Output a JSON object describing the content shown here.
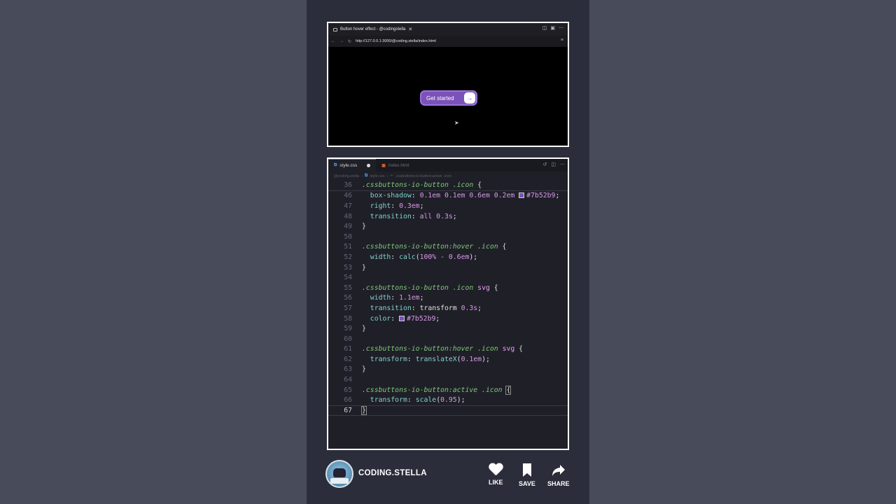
{
  "browser": {
    "tab_title": "Button hover effect - @codingstella",
    "tab_close": "✕",
    "url": "http://127.0.0.1:3000/@coding.stella/index.html",
    "button_label": "Get started",
    "button_icon": "→",
    "accent_color": "#7b52b9"
  },
  "editor": {
    "tabs": [
      {
        "label": "style.css",
        "icon": "css-icon",
        "modified": true
      },
      {
        "label": "index.html",
        "icon": "html-icon",
        "modified": false
      }
    ],
    "breadcrumb": [
      "@coding.stella",
      "style.css",
      ".cssbuttons-io-button:active .icon"
    ],
    "sticky_line": {
      "num": "36",
      "text": ".cssbuttons-io-button .icon {"
    },
    "lines": [
      {
        "num": "46",
        "text": "  box-shadow: 0.1em 0.1em 0.6em 0.2em #7b52b9;"
      },
      {
        "num": "47",
        "text": "  right: 0.3em;"
      },
      {
        "num": "48",
        "text": "  transition: all 0.3s;"
      },
      {
        "num": "49",
        "text": "}"
      },
      {
        "num": "50",
        "text": ""
      },
      {
        "num": "51",
        "text": ".cssbuttons-io-button:hover .icon {"
      },
      {
        "num": "52",
        "text": "  width: calc(100% - 0.6em);"
      },
      {
        "num": "53",
        "text": "}"
      },
      {
        "num": "54",
        "text": ""
      },
      {
        "num": "55",
        "text": ".cssbuttons-io-button .icon svg {"
      },
      {
        "num": "56",
        "text": "  width: 1.1em;"
      },
      {
        "num": "57",
        "text": "  transition: transform 0.3s;"
      },
      {
        "num": "58",
        "text": "  color: #7b52b9;"
      },
      {
        "num": "59",
        "text": "}"
      },
      {
        "num": "60",
        "text": ""
      },
      {
        "num": "61",
        "text": ".cssbuttons-io-button:hover .icon svg {"
      },
      {
        "num": "62",
        "text": "  transform: translateX(0.1em);"
      },
      {
        "num": "63",
        "text": "}"
      },
      {
        "num": "64",
        "text": ""
      },
      {
        "num": "65",
        "text": ".cssbuttons-io-button:active .icon {"
      },
      {
        "num": "66",
        "text": "  transform: scale(0.95);"
      },
      {
        "num": "67",
        "text": "}"
      }
    ]
  },
  "footer": {
    "channel": "CODING.STELLA",
    "like": "LIKE",
    "save": "SAVE",
    "share": "SHARE"
  }
}
